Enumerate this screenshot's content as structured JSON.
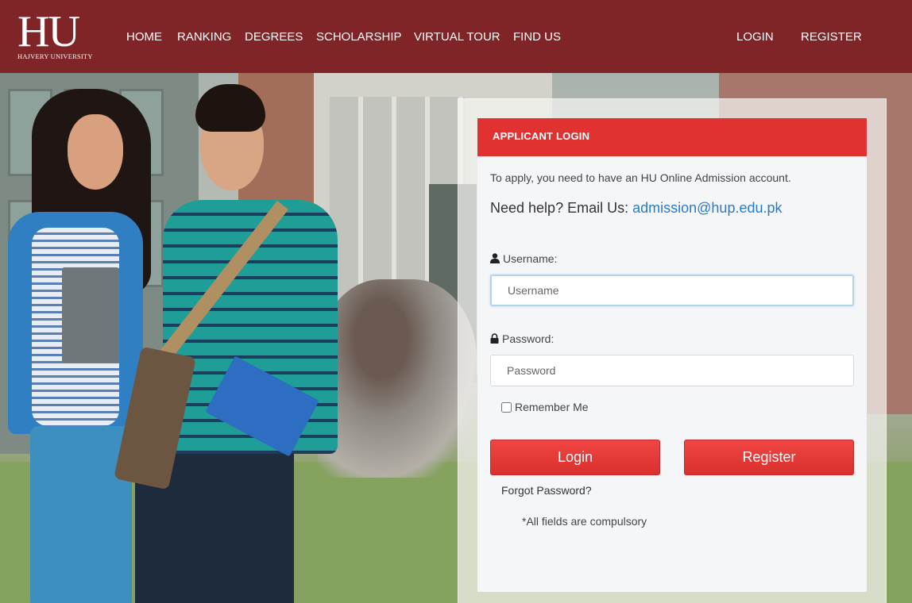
{
  "brand": {
    "logo_mark": "HU",
    "logo_sub": "HAJVERY UNIVERSITY"
  },
  "nav": {
    "items": [
      "HOME",
      "RANKING",
      "DEGREES",
      "SCHOLARSHIP",
      "VIRTUAL TOUR",
      "FIND US"
    ],
    "login": "LOGIN",
    "register": "REGISTER"
  },
  "login_panel": {
    "title": "APPLICANT LOGIN",
    "intro": "To apply, you need to have an HU Online Admission account.",
    "help_text": "Need help? Email Us:",
    "help_email": "admission@hup.edu.pk",
    "username_label": "Username:",
    "username_placeholder": "Username",
    "password_label": "Password:",
    "password_placeholder": "Password",
    "remember_label": "Remember Me",
    "login_button": "Login",
    "register_button": "Register",
    "forgot_link": "Forgot Password?",
    "note": "*All fields are compulsory"
  },
  "icons": {
    "username": "user-icon",
    "password": "lock-icon"
  },
  "colors": {
    "header": "#7f2427",
    "panel_header": "#e03331",
    "button": "#e03331",
    "link": "#2a7cc7"
  }
}
